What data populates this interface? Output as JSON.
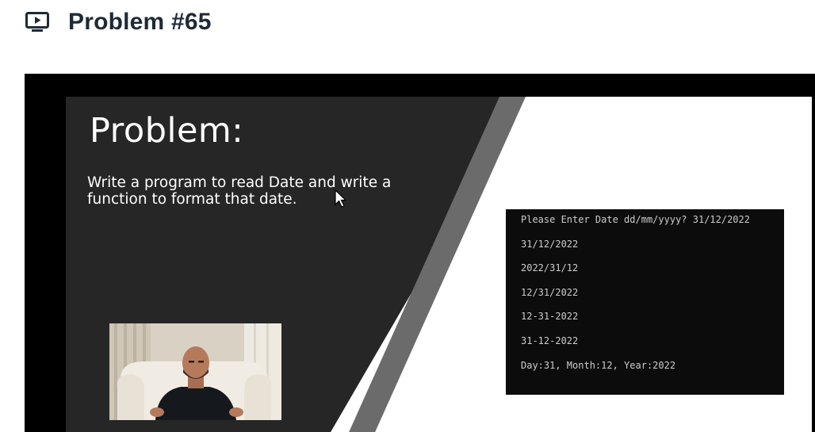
{
  "header": {
    "title": "Problem #65",
    "icon": "video-play-icon"
  },
  "slide": {
    "heading": "Problem:",
    "body_line1": "Write a program to read Date and write a",
    "body_line2": "function to format that date."
  },
  "console": {
    "lines": [
      "Please Enter Date dd/mm/yyyy? 31/12/2022",
      "31/12/2022",
      "2022/31/12",
      "12/31/2022",
      "12-31-2022",
      "31-12-2022",
      "Day:31, Month:12, Year:2022"
    ]
  },
  "colors": {
    "slide_dark": "#262626",
    "slide_stripe": "#6b6b6b",
    "console_bg": "#0c0c0c",
    "title": "#1f2a37"
  }
}
